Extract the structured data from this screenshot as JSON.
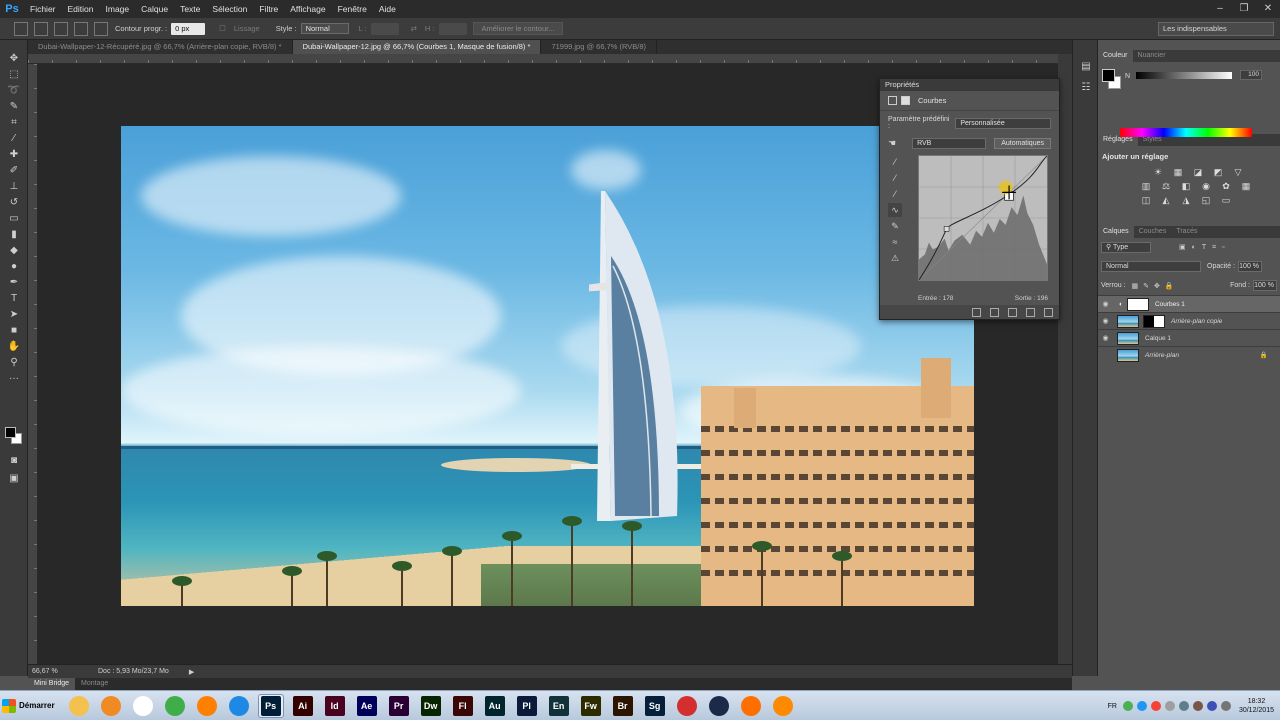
{
  "app": {
    "logo": "Ps"
  },
  "menubar": {
    "items": [
      "Fichier",
      "Edition",
      "Image",
      "Calque",
      "Texte",
      "Sélection",
      "Filtre",
      "Affichage",
      "Fenêtre",
      "Aide"
    ],
    "window_controls": [
      "–",
      "❐",
      "✕"
    ]
  },
  "options": {
    "contour_label": "Contour progr. :",
    "contour_value": "0 px",
    "lissage_label": "Lissage",
    "style_label": "Style :",
    "style_value": "Normal",
    "l_label": "L :",
    "h_label": "H :",
    "refine_button": "Améliorer le contour...",
    "workspace": "Les indispensables"
  },
  "doc_tabs": [
    {
      "label": "Dubai-Wallpaper-12-Récupéré.jpg @ 66,7% (Arrière-plan copie, RVB/8) *",
      "active": false
    },
    {
      "label": "Dubai-Wallpaper-12.jpg @ 66,7% (Courbes 1, Masque de fusion/8) *",
      "active": true
    },
    {
      "label": "71999.jpg @ 66,7% (RVB/8)",
      "active": false
    }
  ],
  "properties": {
    "title": "Propriétés",
    "adjustment_name": "Courbes",
    "preset_label": "Paramètre prédéfini :",
    "preset_value": "Personnalisée",
    "channel_value": "RVB",
    "auto_button": "Automatiques",
    "input_label": "Entrée :",
    "input_value": "178",
    "output_label": "Sortie :",
    "output_value": "196"
  },
  "color_panel": {
    "tabs": [
      "Couleur",
      "Nuancier"
    ],
    "channel": "N",
    "value": "100"
  },
  "adjustments_panel": {
    "tabs": [
      "Réglages",
      "Styles"
    ],
    "title": "Ajouter un réglage"
  },
  "layers_panel": {
    "tabs": [
      "Calques",
      "Couches",
      "Tracés"
    ],
    "filter_value": "Type",
    "blend_mode": "Normal",
    "opacity_label": "Opacité :",
    "opacity_value": "100 %",
    "lock_label": "Verrou :",
    "fill_label": "Fond :",
    "fill_value": "100 %",
    "layers": [
      {
        "name": "Courbes 1",
        "selected": true,
        "visible": true,
        "italic": false
      },
      {
        "name": "Arrière-plan copie",
        "selected": false,
        "visible": true,
        "italic": true
      },
      {
        "name": "Calque 1",
        "selected": false,
        "visible": true,
        "italic": false
      },
      {
        "name": "Arrière-plan",
        "selected": false,
        "visible": false,
        "italic": true
      }
    ]
  },
  "status": {
    "zoom": "66,67 %",
    "doc_size": "Doc : 5,93 Mo/23,7 Mo"
  },
  "mini_bridge": {
    "tabs": [
      "Mini Bridge",
      "Montage"
    ]
  },
  "taskbar": {
    "start_label": "Démarrer",
    "apps": [
      {
        "label": "",
        "color": "#f2c14e"
      },
      {
        "label": "",
        "color": "#f08a24"
      },
      {
        "label": "",
        "color": "#ffffff"
      },
      {
        "label": "",
        "color": "#3fae49"
      },
      {
        "label": "",
        "color": "#ff7f00"
      },
      {
        "label": "",
        "color": "#1e88e5"
      },
      {
        "label": "Ps",
        "color": "#001e36"
      },
      {
        "label": "Ai",
        "color": "#330000"
      },
      {
        "label": "Id",
        "color": "#49021f"
      },
      {
        "label": "Ae",
        "color": "#00005b"
      },
      {
        "label": "Pr",
        "color": "#2a0034"
      },
      {
        "label": "Dw",
        "color": "#072401"
      },
      {
        "label": "Fl",
        "color": "#3b0606"
      },
      {
        "label": "Au",
        "color": "#00252c"
      },
      {
        "label": "Pl",
        "color": "#0b1a3b"
      },
      {
        "label": "En",
        "color": "#12323a"
      },
      {
        "label": "Fw",
        "color": "#2e2a00"
      },
      {
        "label": "Br",
        "color": "#2b1400"
      },
      {
        "label": "Sg",
        "color": "#061e3a"
      },
      {
        "label": "",
        "color": "#d32f2f"
      },
      {
        "label": "",
        "color": "#1c2a4a"
      },
      {
        "label": "",
        "color": "#ff6f00"
      },
      {
        "label": "",
        "color": "#ff8a00"
      }
    ],
    "lang": "FR",
    "time": "18:32",
    "date": "30/12/2015"
  }
}
